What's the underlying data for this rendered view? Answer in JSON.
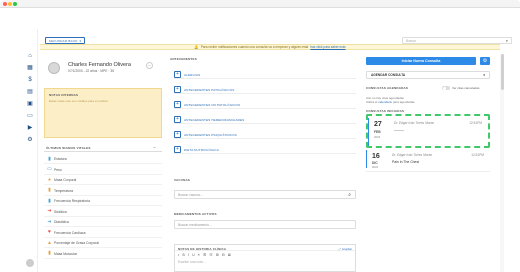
{
  "mac_dots": {
    "close": "#ff5f57",
    "min": "#febc2e",
    "max": "#28c840"
  },
  "app": {
    "brand_color": "#1f4f86",
    "accent": "#2d8ae6"
  },
  "sidebar": {
    "items": [
      {
        "icon": "home-icon",
        "glyph": "⌂"
      },
      {
        "icon": "calendar-icon",
        "glyph": "▦"
      },
      {
        "icon": "dollar-icon",
        "glyph": "$"
      },
      {
        "icon": "document-icon",
        "glyph": "▤"
      },
      {
        "icon": "grid-icon",
        "glyph": "▣"
      },
      {
        "icon": "chat-icon",
        "glyph": "▭"
      },
      {
        "icon": "video-icon",
        "glyph": "▶"
      },
      {
        "icon": "settings-icon",
        "glyph": "⚙"
      }
    ],
    "bottom_icon": "user-icon"
  },
  "topbar": {
    "secondary_button": "SECUNDAR BANO",
    "search_placeholder": "Buscar"
  },
  "notice": {
    "text": "Para recibir notificaciones cuando una consulta va a empezar y alguien está",
    "link": "haz click para saber más"
  },
  "patient": {
    "name": "Charles Fernando Olivera",
    "info": "07/1/2000 - 22 años · MPE · 35"
  },
  "notes": {
    "title": "NOTAS INTERNAS",
    "placeholder": "Estas notas solo son visibles para el médico"
  },
  "vitals": {
    "title": "ÚLTIMOS SIGNOS VITALES",
    "items": [
      {
        "label": "Estatura",
        "icon": "ruler-icon",
        "color": "#3fa7d6",
        "glyph": "▮"
      },
      {
        "label": "Peso",
        "icon": "scale-icon",
        "color": "#3f8ee6",
        "glyph": "▭"
      },
      {
        "label": "Masa Corporal",
        "icon": "body-icon",
        "color": "#e6a23f",
        "glyph": "●"
      },
      {
        "label": "Temperatura",
        "icon": "thermometer-icon",
        "color": "#e6a23f",
        "glyph": "▮"
      },
      {
        "label": "Frecuencia Respiratoria",
        "icon": "lungs-icon",
        "color": "#3fa7d6",
        "glyph": "▮"
      },
      {
        "label": "Sistólica",
        "icon": "arrow-up-icon",
        "color": "#e6473f",
        "glyph": "➜"
      },
      {
        "label": "Diastólica",
        "icon": "arrow-down-icon",
        "color": "#3fa7d6",
        "glyph": "➜"
      },
      {
        "label": "Frecuencia Cardíaca",
        "icon": "heart-icon",
        "color": "#e6473f",
        "glyph": "♥"
      },
      {
        "label": "Porcentaje de Grasa Corporal",
        "icon": "fat-icon",
        "color": "#e6a23f",
        "glyph": "▲"
      },
      {
        "label": "Masa Muscular",
        "icon": "muscle-icon",
        "color": "#e6a23f",
        "glyph": "▮"
      }
    ]
  },
  "antecedentes": {
    "title": "ANTECEDENTES",
    "items": [
      "ALERGIAS",
      "ANTECEDENTES PATOLÓGICOS",
      "ANTECEDENTES NO PATOLÓGICOS",
      "ANTECEDENTES HEREDOFAMILIARES",
      "ANTECEDENTES PSIQUIÁTRICOS",
      "DIETA NUTRIOLÓGICA"
    ]
  },
  "vacunas": {
    "title": "VACUNAS",
    "placeholder": "Buscar vacuna..."
  },
  "medicamentos": {
    "title": "MEDICAMENTOS ACTIVOS",
    "placeholder": "Buscar medicamento..."
  },
  "notas_historia": {
    "title": "NOTAS DE HISTORIA CLÍNICA",
    "link": "Ampliar",
    "placeholder": "Escribe una nota...",
    "toolbar": "• B I U ≡ ☰ ☷ ⊞ ⊟ ⊠"
  },
  "right": {
    "primary_button": "Iniciar Nueva Consulta",
    "agendar": "AGENDAR CONSULTA",
    "consultas_agendadas": "CONSULTAS AGENDADAS",
    "toggle_label": "Ver citas canceladas",
    "empty1": "Aún no hay citas agendadas",
    "empty2_prefix": "Utiliza el",
    "empty2_link": "calendario",
    "empty2_suffix": "para agendarlas.",
    "consultas_iniciadas": "CONSULTAS INICIADAS",
    "appointments": [
      {
        "day": "27",
        "month": "FEB",
        "year": "2023",
        "doctor": "Dr. Edgar Iván Torres Moran",
        "time": "12:51PM",
        "subject": "———"
      },
      {
        "day": "16",
        "month": "DIC",
        "year": "2022",
        "doctor": "Dr. Edgar Iván Torres Moran",
        "time": "12:51PM",
        "subject": "Pain In The Chest"
      }
    ]
  }
}
